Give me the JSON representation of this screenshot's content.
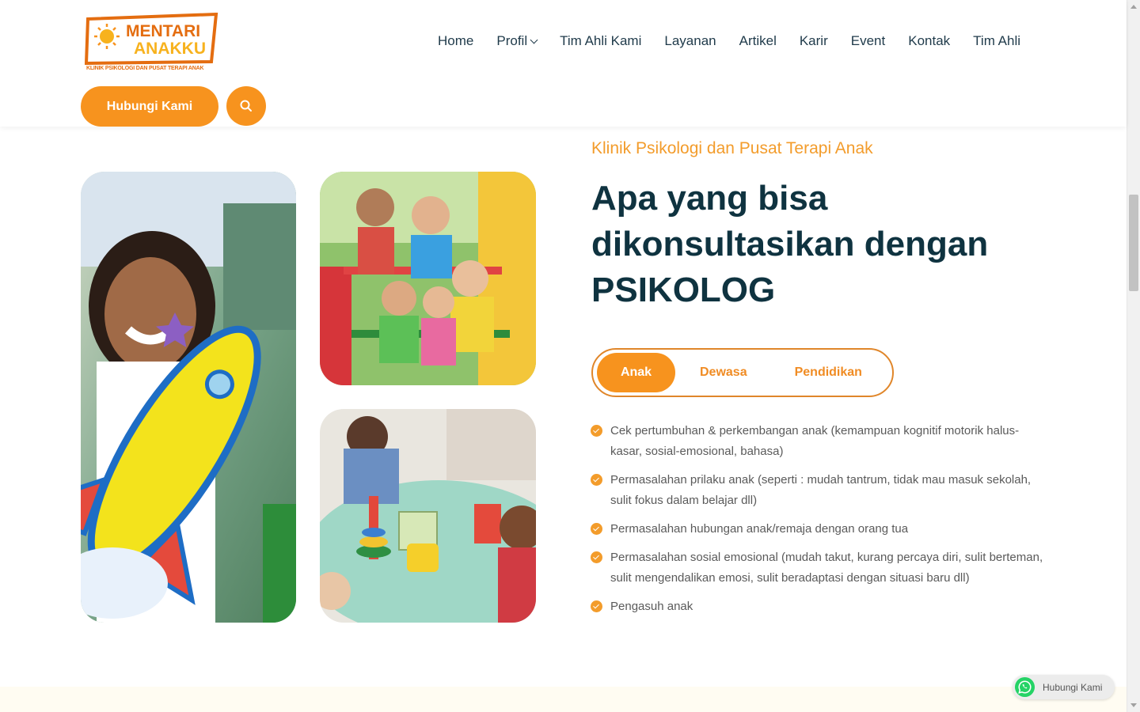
{
  "brand": {
    "logo_line1": "MENTARI",
    "logo_line2": "ANAKKU",
    "logo_caption": "KLINIK PSIKOLOGI DAN PUSAT TERAPI ANAK"
  },
  "nav": {
    "items": [
      {
        "label": "Home"
      },
      {
        "label": "Profil"
      },
      {
        "label": "Tim Ahli Kami"
      },
      {
        "label": "Layanan"
      },
      {
        "label": "Artikel"
      },
      {
        "label": "Karir"
      },
      {
        "label": "Event"
      },
      {
        "label": "Kontak"
      },
      {
        "label": "Tim Ahli"
      }
    ],
    "contact_button": "Hubungi Kami"
  },
  "section": {
    "kicker": "Klinik Psikologi dan Pusat Terapi Anak",
    "headline": "Apa yang bisa dikonsultasikan dengan PSIKOLOG",
    "tabs": [
      {
        "label": "Anak",
        "active": true
      },
      {
        "label": "Dewasa",
        "active": false
      },
      {
        "label": "Pendidikan",
        "active": false
      }
    ],
    "items": [
      "Cek pertumbuhan & perkembangan anak (kemampuan kognitif motorik halus-kasar, sosial-emosional, bahasa)",
      "Permasalahan prilaku anak (seperti : mudah tantrum, tidak mau masuk sekolah, sulit fokus dalam belajar dll)",
      "Permasalahan hubungan anak/remaja dengan orang tua",
      "Permasalahan sosial emosional (mudah takut, kurang percaya diri, sulit berteman, sulit mengendalikan emosi, sulit beradaptasi dengan situasi baru dll)",
      "Pengasuh anak"
    ]
  },
  "whatsapp": {
    "label": "Hubungi Kami"
  },
  "colors": {
    "accent": "#f7931e",
    "heading": "#0f3340",
    "nav_text": "#1f3a4a"
  }
}
